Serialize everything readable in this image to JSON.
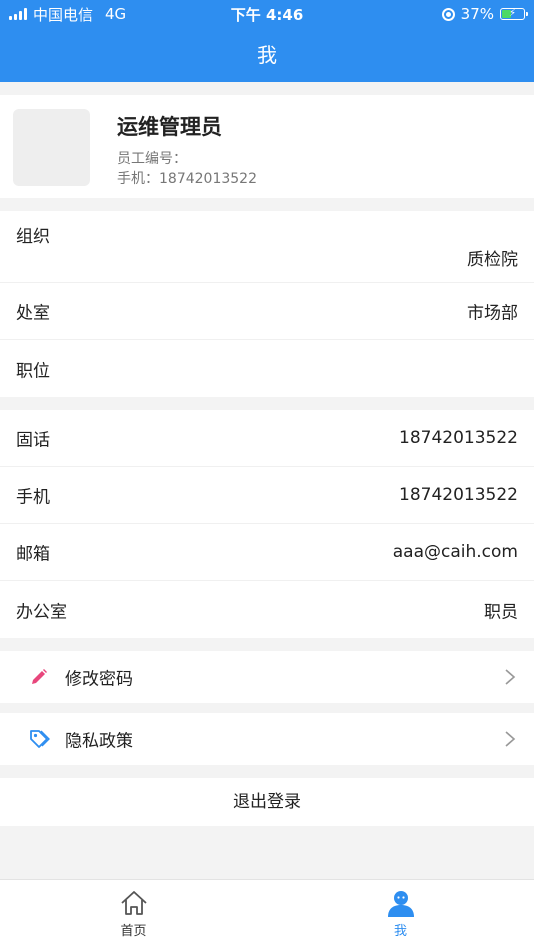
{
  "status_bar": {
    "carrier": "中国电信",
    "network": "4G",
    "time": "下午 4:46",
    "battery": "37%",
    "battery_level": 0.37
  },
  "nav": {
    "title": "我"
  },
  "profile": {
    "name": "运维管理员",
    "employee_id_label": "员工编号：",
    "employee_id": "",
    "phone_label": "手机：",
    "phone": "18742013522"
  },
  "info_group1": [
    {
      "label": "组织",
      "value": "质检院"
    },
    {
      "label": "处室",
      "value": "市场部"
    },
    {
      "label": "职位",
      "value": ""
    }
  ],
  "info_group2": [
    {
      "label": "固话",
      "value": "18742013522"
    },
    {
      "label": "手机",
      "value": "18742013522"
    },
    {
      "label": "邮箱",
      "value": "aaa@caih.com"
    },
    {
      "label": "办公室",
      "value": "职员"
    }
  ],
  "actions": {
    "change_password": "修改密码",
    "privacy_policy": "隐私政策",
    "logout": "退出登录"
  },
  "tabs": [
    {
      "label": "首页",
      "icon": "home-icon"
    },
    {
      "label": "我",
      "icon": "user-icon",
      "active": true
    }
  ],
  "colors": {
    "primary": "#2e8ef0",
    "pencil": "#e8467c",
    "tag": "#2e8ef0"
  }
}
